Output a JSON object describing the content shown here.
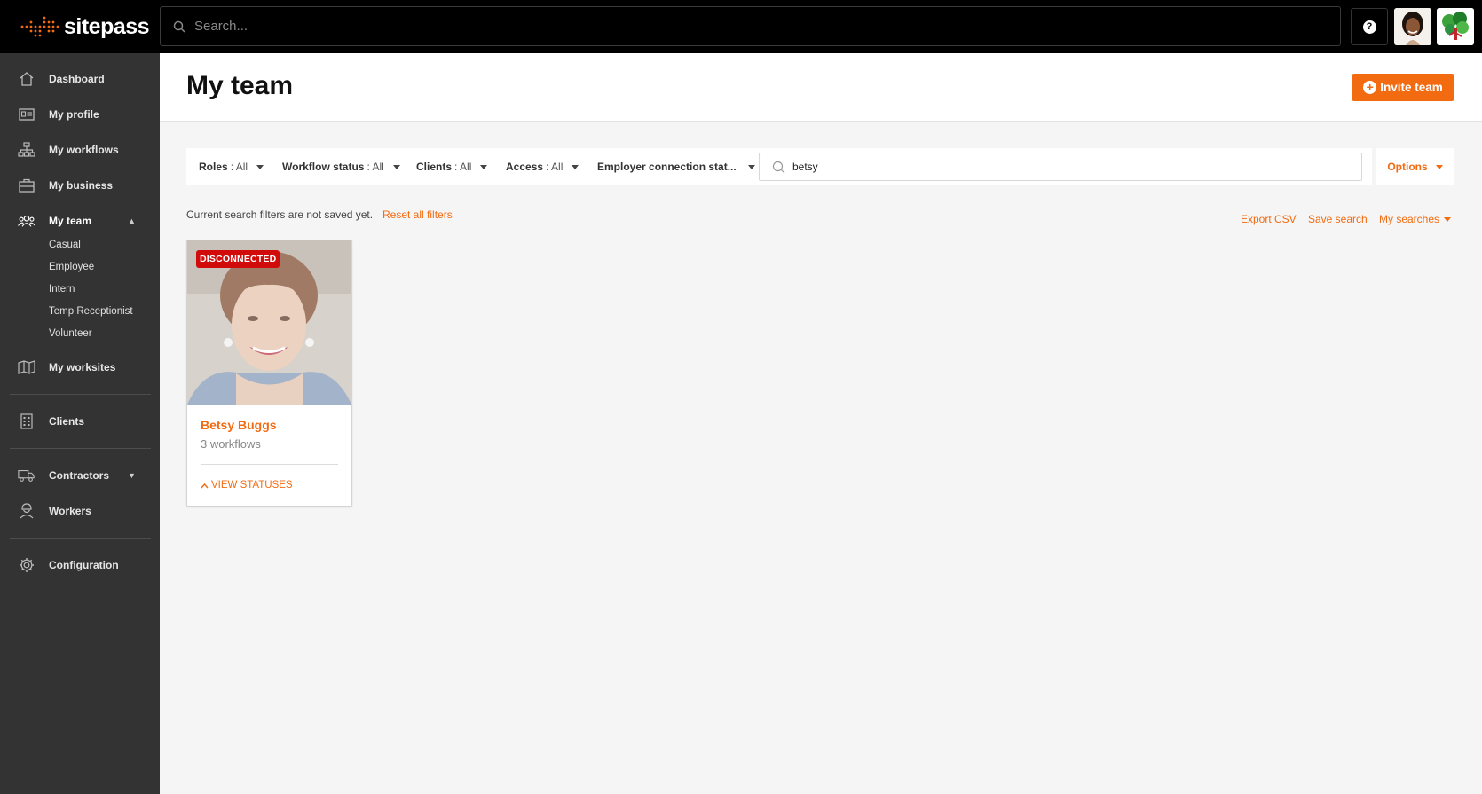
{
  "app": {
    "brand": "sitepass"
  },
  "topbar": {
    "search_placeholder": "Search...",
    "help_label": "?"
  },
  "sidebar": {
    "items": [
      {
        "label": "Dashboard",
        "icon": "home-icon"
      },
      {
        "label": "My profile",
        "icon": "id-card-icon"
      },
      {
        "label": "My workflows",
        "icon": "workflow-icon"
      },
      {
        "label": "My business",
        "icon": "briefcase-icon"
      },
      {
        "label": "My team",
        "icon": "team-icon",
        "active": true
      },
      {
        "label": "My worksites",
        "icon": "map-icon"
      },
      {
        "label": "Clients",
        "icon": "building-icon"
      },
      {
        "label": "Contractors",
        "icon": "truck-icon"
      },
      {
        "label": "Workers",
        "icon": "worker-icon"
      },
      {
        "label": "Configuration",
        "icon": "gear-icon"
      }
    ],
    "team_subitems": [
      "Casual",
      "Employee",
      "Intern",
      "Temp Receptionist",
      "Volunteer"
    ]
  },
  "page": {
    "title": "My team",
    "invite_label": "Invite team"
  },
  "filters": [
    {
      "label": "Roles",
      "value": ": All"
    },
    {
      "label": "Workflow status",
      "value": ": All"
    },
    {
      "label": "Clients",
      "value": ": All"
    },
    {
      "label": "Access",
      "value": ": All"
    },
    {
      "label": "Employer connection stat...",
      "value": ""
    }
  ],
  "filter_search": {
    "value": "betsy"
  },
  "options_label": "Options",
  "filter_note": "Current search filters are not saved yet.",
  "reset_label": "Reset all filters",
  "actions": {
    "export": "Export CSV",
    "save": "Save search",
    "my_searches": "My searches"
  },
  "cards": [
    {
      "name": "Betsy Buggs",
      "workflows": "3 workflows",
      "badge": "DISCONNECTED",
      "status_link": "VIEW STATUSES"
    }
  ],
  "colors": {
    "accent": "#f26b11",
    "badge": "#d10a0a",
    "sidebar": "#333333",
    "topbar": "#000000"
  }
}
